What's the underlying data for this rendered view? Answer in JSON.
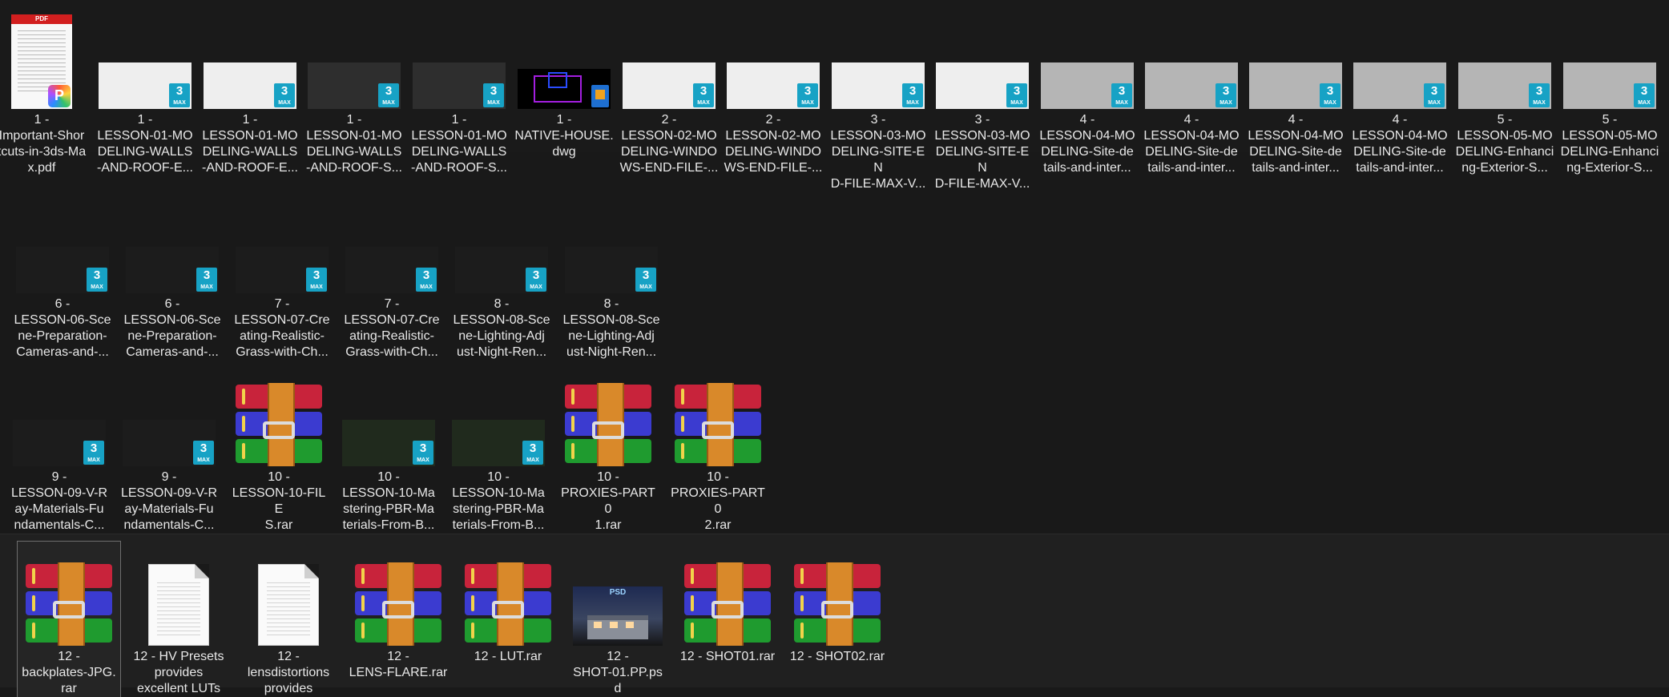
{
  "rows": [
    [
      {
        "type": "pdf",
        "name": "1 - Important-Shortcuts-in-3ds-Max.pdf",
        "lines": [
          "1 -",
          "Important-Shor",
          "tcuts-in-3ds-Ma",
          "x.pdf"
        ]
      },
      {
        "type": "max",
        "variant": "white",
        "lines": [
          "1 -",
          "LESSON-01-MO",
          "DELING-WALLS",
          "-AND-ROOF-E..."
        ]
      },
      {
        "type": "max",
        "variant": "white",
        "lines": [
          "1 -",
          "LESSON-01-MO",
          "DELING-WALLS",
          "-AND-ROOF-E..."
        ]
      },
      {
        "type": "max",
        "variant": "dark",
        "lines": [
          "1 -",
          "LESSON-01-MO",
          "DELING-WALLS",
          "-AND-ROOF-S..."
        ]
      },
      {
        "type": "max",
        "variant": "dark",
        "lines": [
          "1 -",
          "LESSON-01-MO",
          "DELING-WALLS",
          "-AND-ROOF-S..."
        ]
      },
      {
        "type": "dwg",
        "lines": [
          "1 -",
          "NATIVE-HOUSE.",
          "dwg"
        ]
      },
      {
        "type": "max",
        "variant": "white",
        "lines": [
          "2 -",
          "LESSON-02-MO",
          "DELING-WINDO",
          "WS-END-FILE-..."
        ]
      },
      {
        "type": "max",
        "variant": "white",
        "lines": [
          "2 -",
          "LESSON-02-MO",
          "DELING-WINDO",
          "WS-END-FILE-..."
        ]
      },
      {
        "type": "max",
        "variant": "white",
        "lines": [
          "3 -",
          "LESSON-03-MO",
          "DELING-SITE-EN",
          "D-FILE-MAX-V..."
        ]
      },
      {
        "type": "max",
        "variant": "white",
        "lines": [
          "3 -",
          "LESSON-03-MO",
          "DELING-SITE-EN",
          "D-FILE-MAX-V..."
        ]
      },
      {
        "type": "max",
        "variant": "site",
        "lines": [
          "4 -",
          "LESSON-04-MO",
          "DELING-Site-de",
          "tails-and-inter..."
        ]
      },
      {
        "type": "max",
        "variant": "site",
        "lines": [
          "4 -",
          "LESSON-04-MO",
          "DELING-Site-de",
          "tails-and-inter..."
        ]
      },
      {
        "type": "max",
        "variant": "site",
        "lines": [
          "4 -",
          "LESSON-04-MO",
          "DELING-Site-de",
          "tails-and-inter..."
        ]
      },
      {
        "type": "max",
        "variant": "site",
        "lines": [
          "4 -",
          "LESSON-04-MO",
          "DELING-Site-de",
          "tails-and-inter..."
        ]
      },
      {
        "type": "max",
        "variant": "site",
        "lines": [
          "5 -",
          "LESSON-05-MO",
          "DELING-Enhanci",
          "ng-Exterior-S..."
        ]
      },
      {
        "type": "max",
        "variant": "site",
        "lines": [
          "5 -",
          "LESSON-05-MO",
          "DELING-Enhanci",
          "ng-Exterior-S..."
        ]
      }
    ],
    [
      {
        "type": "max",
        "variant": "night",
        "lines": [
          "6 -",
          "LESSON-06-Sce",
          "ne-Preparation-",
          "Cameras-and-..."
        ]
      },
      {
        "type": "max",
        "variant": "night",
        "lines": [
          "6 -",
          "LESSON-06-Sce",
          "ne-Preparation-",
          "Cameras-and-..."
        ]
      },
      {
        "type": "max",
        "variant": "night",
        "lines": [
          "7 -",
          "LESSON-07-Cre",
          "ating-Realistic-",
          "Grass-with-Ch..."
        ]
      },
      {
        "type": "max",
        "variant": "night",
        "lines": [
          "7 -",
          "LESSON-07-Cre",
          "ating-Realistic-",
          "Grass-with-Ch..."
        ]
      },
      {
        "type": "max",
        "variant": "night",
        "lines": [
          "8 -",
          "LESSON-08-Sce",
          "ne-Lighting-Adj",
          "ust-Night-Ren..."
        ]
      },
      {
        "type": "max",
        "variant": "night",
        "lines": [
          "8 -",
          "LESSON-08-Sce",
          "ne-Lighting-Adj",
          "ust-Night-Ren..."
        ]
      }
    ],
    [
      {
        "type": "max",
        "variant": "night",
        "lines": [
          "9 -",
          "LESSON-09-V-R",
          "ay-Materials-Fu",
          "ndamentals-C..."
        ]
      },
      {
        "type": "max",
        "variant": "night",
        "lines": [
          "9 -",
          "LESSON-09-V-R",
          "ay-Materials-Fu",
          "ndamentals-C..."
        ]
      },
      {
        "type": "rar",
        "lines": [
          "10 -",
          "LESSON-10-FILE",
          "S.rar"
        ]
      },
      {
        "type": "max",
        "variant": "pbr",
        "lines": [
          "10 -",
          "LESSON-10-Ma",
          "stering-PBR-Ma",
          "terials-From-B..."
        ]
      },
      {
        "type": "max",
        "variant": "pbr",
        "lines": [
          "10 -",
          "LESSON-10-Ma",
          "stering-PBR-Ma",
          "terials-From-B..."
        ]
      },
      {
        "type": "rar",
        "lines": [
          "10 -",
          "PROXIES-PART0",
          "1.rar"
        ]
      },
      {
        "type": "rar",
        "lines": [
          "10 -",
          "PROXIES-PART0",
          "2.rar"
        ]
      }
    ],
    [
      {
        "type": "rar",
        "selected": true,
        "lines": [
          "12 -",
          "backplates-JPG.",
          "rar"
        ]
      },
      {
        "type": "doc",
        "lines": [
          "12 - HV Presets",
          "provides",
          "excellent LUTs"
        ]
      },
      {
        "type": "doc",
        "lines": [
          "12 -",
          "lensdistortions",
          "provides"
        ]
      },
      {
        "type": "rar",
        "lines": [
          "12 -",
          "LENS-FLARE.rar"
        ]
      },
      {
        "type": "rar",
        "lines": [
          "12 - LUT.rar"
        ]
      },
      {
        "type": "psd",
        "lines": [
          "12 -",
          "SHOT-01.PP.ps",
          "d"
        ]
      },
      {
        "type": "rar",
        "lines": [
          "12 - SHOT01.rar"
        ]
      },
      {
        "type": "rar",
        "lines": [
          "12 - SHOT02.rar"
        ]
      }
    ]
  ],
  "badges": {
    "max_number": "3",
    "max_text": "MAX",
    "pdf_bar": "PDF",
    "pdf_app": "P",
    "psd_tag": "PSD"
  },
  "colors": {
    "background": "#191919",
    "max_badge": "#17a2c5",
    "rar_red": "#c8233b",
    "rar_blue": "#3b3bd0",
    "rar_green": "#1f9b2f",
    "selection": "#6d6d6d"
  }
}
